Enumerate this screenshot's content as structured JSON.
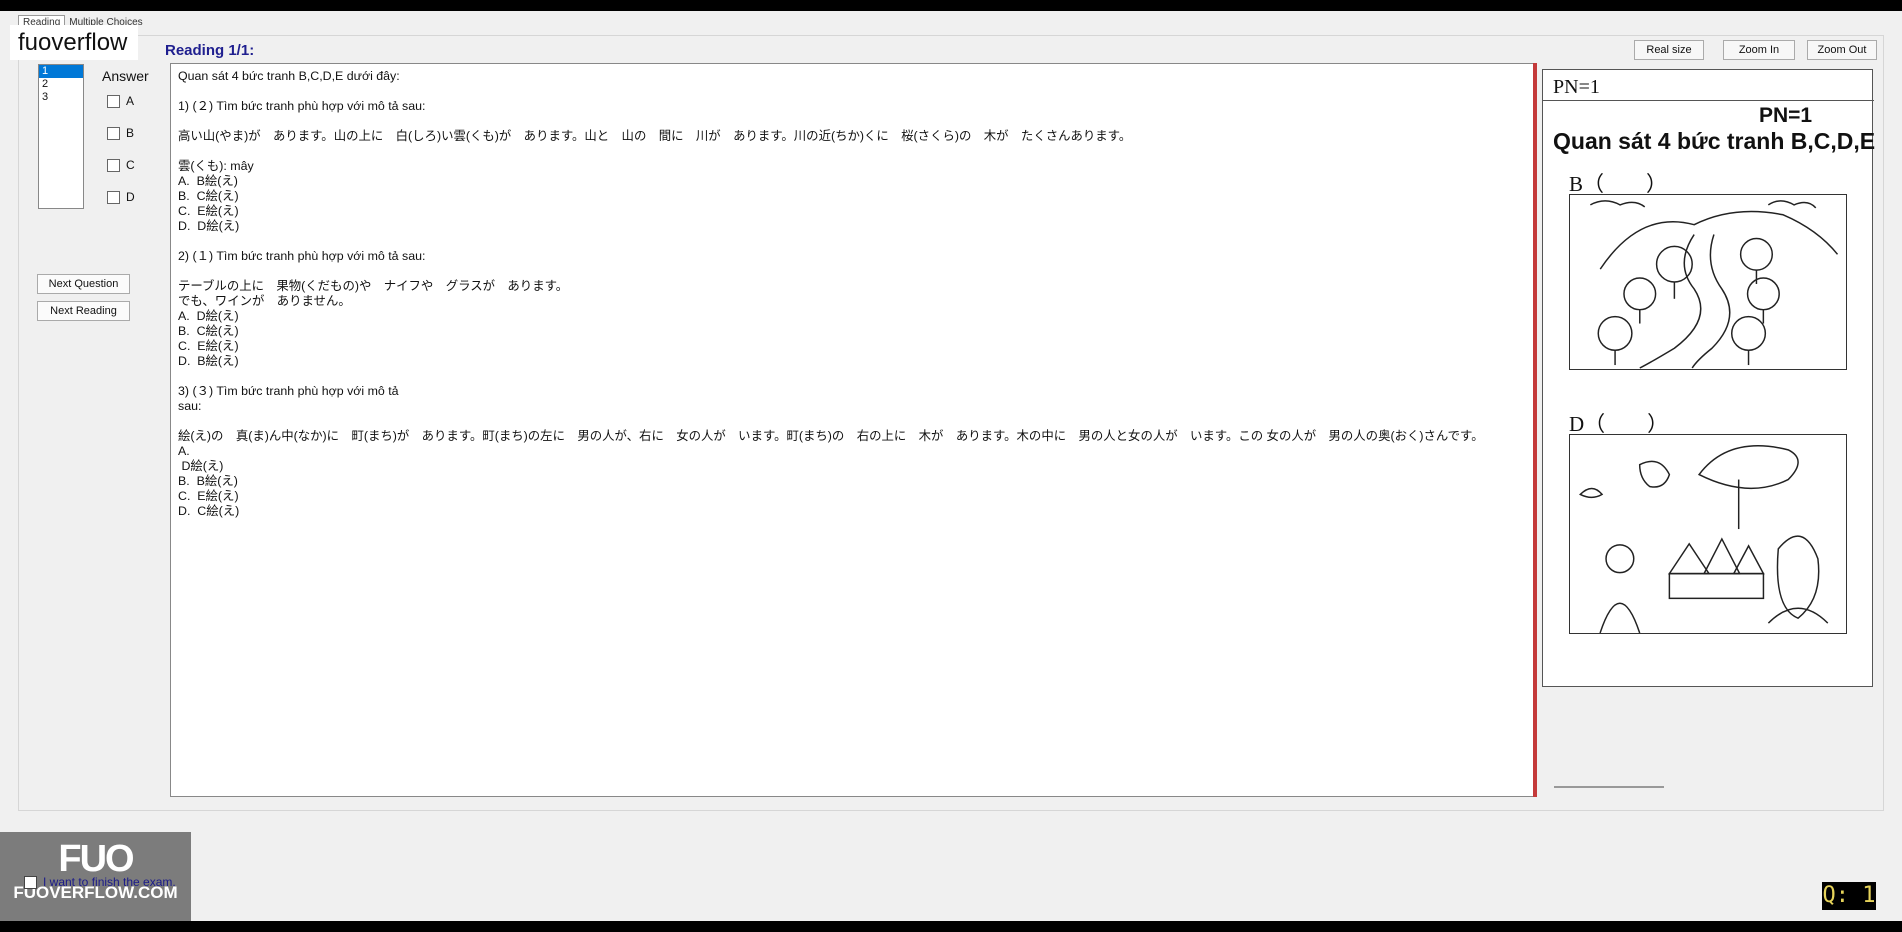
{
  "brand": "fuoverflow",
  "tabs": [
    "Reading",
    "Multiple Choices"
  ],
  "reading_label": "Reading 1/1:",
  "toolbar": {
    "real_size": "Real size",
    "zoom_in": "Zoom In",
    "zoom_out": "Zoom Out"
  },
  "question_list": [
    "1",
    "2",
    "3"
  ],
  "answer": {
    "title": "Answer",
    "options": [
      "A",
      "B",
      "C",
      "D"
    ]
  },
  "buttons": {
    "next_question": "Next Question",
    "next_reading": "Next Reading"
  },
  "reading_lines": [
    "Quan sát 4 bức tranh B,C,D,E dưới đây:",
    "",
    "1) (２) Tìm bức tranh phù hợp với mô tả sau:",
    "",
    "高い山(やま)が　あります。山の上に　白(しろ)い雲(くも)が　あります。山と　山の　間に　川が　あります。川の近(ちか)くに　桜(さくら)の　木が　たくさんあります。",
    "",
    "雲(くも): mây",
    "A.  B絵(え)",
    "B.  C絵(え)",
    "C.  E絵(え)",
    "D.  D絵(え)",
    "",
    "2) (１) Tìm bức tranh phù hợp với mô tả sau:",
    "",
    "テーブルの上に　果物(くだもの)や　ナイフや　グラスが　あります。",
    "でも、ワインが　ありません。",
    "A.  D絵(え)",
    "B.  C絵(え)",
    "C.  E絵(え)",
    "D.  B絵(え)",
    "",
    "3) (３) Tìm bức tranh phù hợp với mô tả",
    "sau:",
    "",
    "絵(え)の　真(ま)ん中(なか)に　町(まち)が　あります。町(まち)の左に　男の人が、右に　女の人が　います。町(まち)の　右の上に　木が　あります。木の中に　男の人と女の人が　います。この 女の人が　男の人の奥(おく)さんです。",
    "A.",
    " D絵(え)",
    "B.  B絵(え)",
    "C.  E絵(え)",
    "D.  C絵(え)"
  ],
  "image_panel": {
    "pn_small": "PN=1",
    "pn_big": "PN=1",
    "title": "Quan sát 4 bức tranh B,C,D,E",
    "picture_b": "B（　　）",
    "picture_d": "D（　　）"
  },
  "logo": {
    "mark": "FUO",
    "text": "FUOVERFLOW.COM"
  },
  "finish_label": "I want to finish the exam.",
  "q_counter": "Q: 1"
}
